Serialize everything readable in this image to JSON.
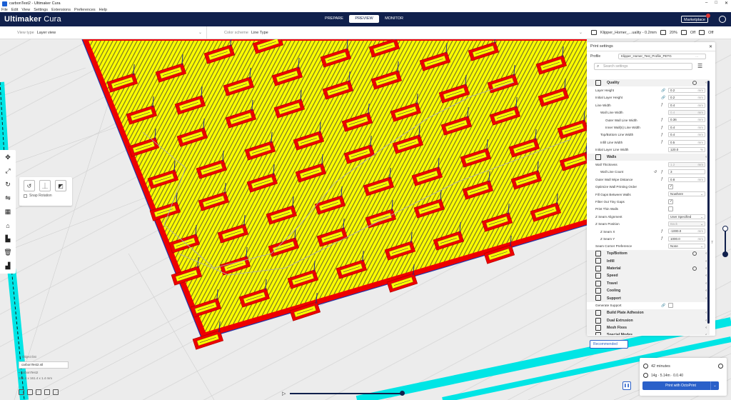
{
  "window": {
    "title": "carbonTest2 - Ultimaker Cura"
  },
  "menu": [
    "File",
    "Edit",
    "View",
    "Settings",
    "Extensions",
    "Preferences",
    "Help"
  ],
  "header": {
    "logo_main": "Ultimaker",
    "logo_sub": "Cura",
    "tabs": [
      {
        "label": "PREPARE"
      },
      {
        "label": "PREVIEW",
        "active": true
      },
      {
        "label": "MONITOR"
      }
    ],
    "marketplace": "Marketplace"
  },
  "view_bar": {
    "view_type_label": "View type",
    "view_type_value": "Layer view",
    "color_scheme_label": "Color scheme",
    "color_scheme_value": "Line Type"
  },
  "printer_bar": {
    "profile_text": "Klipper_Homer_...uality - 0.2mm",
    "infill": "20%",
    "support": "Off",
    "adhesion": "Off"
  },
  "settings": {
    "title": "Print settings",
    "profile_label": "Profile",
    "profile_value": "Klipper_Homer_Test_Profile_PETG",
    "profile_suffix": "...",
    "search_placeholder": "Search settings",
    "rows": [
      {
        "type": "cat",
        "label": "Quality",
        "info": true
      },
      {
        "type": "setting",
        "label": "Layer Height",
        "indent": 0,
        "value": "0.2",
        "unit": "mm",
        "mark": "link"
      },
      {
        "type": "setting",
        "label": "Initial Layer Height",
        "indent": 0,
        "value": "0.2",
        "unit": "mm",
        "mark": "link"
      },
      {
        "type": "setting",
        "label": "Line Width",
        "indent": 0,
        "value": "0.4",
        "unit": "mm",
        "mark": "fx"
      },
      {
        "type": "setting",
        "label": "Wall Line Width",
        "indent": 1,
        "value": "0.4",
        "unit": "mm",
        "disabled": true
      },
      {
        "type": "setting",
        "label": "Outer Wall Line Width",
        "indent": 2,
        "value": "0.36",
        "unit": "mm",
        "mark": "fx"
      },
      {
        "type": "setting",
        "label": "Inner Wall(s) Line Width",
        "indent": 2,
        "value": "0.4",
        "unit": "mm",
        "mark": "fx"
      },
      {
        "type": "setting",
        "label": "Top/Bottom Line Width",
        "indent": 1,
        "value": "0.4",
        "unit": "mm",
        "mark": "fx"
      },
      {
        "type": "setting",
        "label": "Infill Line Width",
        "indent": 1,
        "value": "0.5",
        "unit": "mm",
        "mark": "fx"
      },
      {
        "type": "setting",
        "label": "Initial Layer Line Width",
        "indent": 0,
        "value": "120.0",
        "unit": "%"
      },
      {
        "type": "cat",
        "label": "Walls"
      },
      {
        "type": "setting",
        "label": "Wall Thickness",
        "indent": 0,
        "value": "1.2",
        "unit": "mm",
        "disabled": true
      },
      {
        "type": "setting",
        "label": "Wall Line Count",
        "indent": 1,
        "value": "3",
        "unit": "",
        "mark": "reset-fx"
      },
      {
        "type": "setting",
        "label": "Outer Wall Wipe Distance",
        "indent": 0,
        "value": "0.8",
        "unit": "mm",
        "mark": "fx"
      },
      {
        "type": "check",
        "label": "Optimize Wall Printing Order",
        "checked": true
      },
      {
        "type": "setting",
        "label": "Fill Gaps Between Walls",
        "indent": 0,
        "value": "Nowhere",
        "unit": "⌄",
        "dropdown": true
      },
      {
        "type": "check",
        "label": "Filter Out Tiny Gaps",
        "checked": true
      },
      {
        "type": "check",
        "label": "Print Thin Walls",
        "checked": false
      },
      {
        "type": "setting",
        "label": "Z Seam Alignment",
        "indent": 0,
        "value": "User Specified",
        "unit": "⌄",
        "dropdown": true
      },
      {
        "type": "setting",
        "label": "Z Seam Position",
        "indent": 0,
        "value": "Back",
        "unit": "⌄",
        "dropdown": true,
        "disabled": true
      },
      {
        "type": "setting",
        "label": "Z Seam X",
        "indent": 1,
        "value": "-1000.0",
        "unit": "mm",
        "mark": "fx"
      },
      {
        "type": "setting",
        "label": "Z Seam Y",
        "indent": 1,
        "value": "1000.0",
        "unit": "mm",
        "mark": "fx"
      },
      {
        "type": "setting",
        "label": "Seam Corner Preference",
        "indent": 0,
        "value": "None",
        "unit": "⌄",
        "dropdown": true
      },
      {
        "type": "cat",
        "label": "Top/Bottom",
        "info": true
      },
      {
        "type": "cat",
        "label": "Infill"
      },
      {
        "type": "cat",
        "label": "Material",
        "info": true
      },
      {
        "type": "cat",
        "label": "Speed"
      },
      {
        "type": "cat",
        "label": "Travel"
      },
      {
        "type": "cat",
        "label": "Cooling"
      },
      {
        "type": "cat",
        "label": "Support"
      },
      {
        "type": "check",
        "label": "Generate Support",
        "checked": false,
        "mark": "link"
      },
      {
        "type": "cat",
        "label": "Build Plate Adhesion"
      },
      {
        "type": "cat",
        "label": "Dual Extrusion"
      },
      {
        "type": "cat",
        "label": "Mesh Fixes"
      },
      {
        "type": "cat",
        "label": "Special Modes"
      }
    ],
    "recommended": "Recommended"
  },
  "rotate_panel": {
    "snap_label": "Snap Rotation"
  },
  "print_panel": {
    "time": "42 minutes",
    "material": "14g · 5.14m · 0.0.40",
    "button": "Print with OctoPrint"
  },
  "object_list": {
    "header": "Object list",
    "name": "carbonTest2.stl",
    "sub": "carbonTest2",
    "dims": "161.4 x 161.4 x 1.4 mm"
  },
  "layer_label": "7",
  "colors": {
    "header": "#10204c",
    "accent": "#2a60c9",
    "yellow": "#ffff00",
    "red": "#ff0000",
    "cyan": "#00ffff"
  }
}
